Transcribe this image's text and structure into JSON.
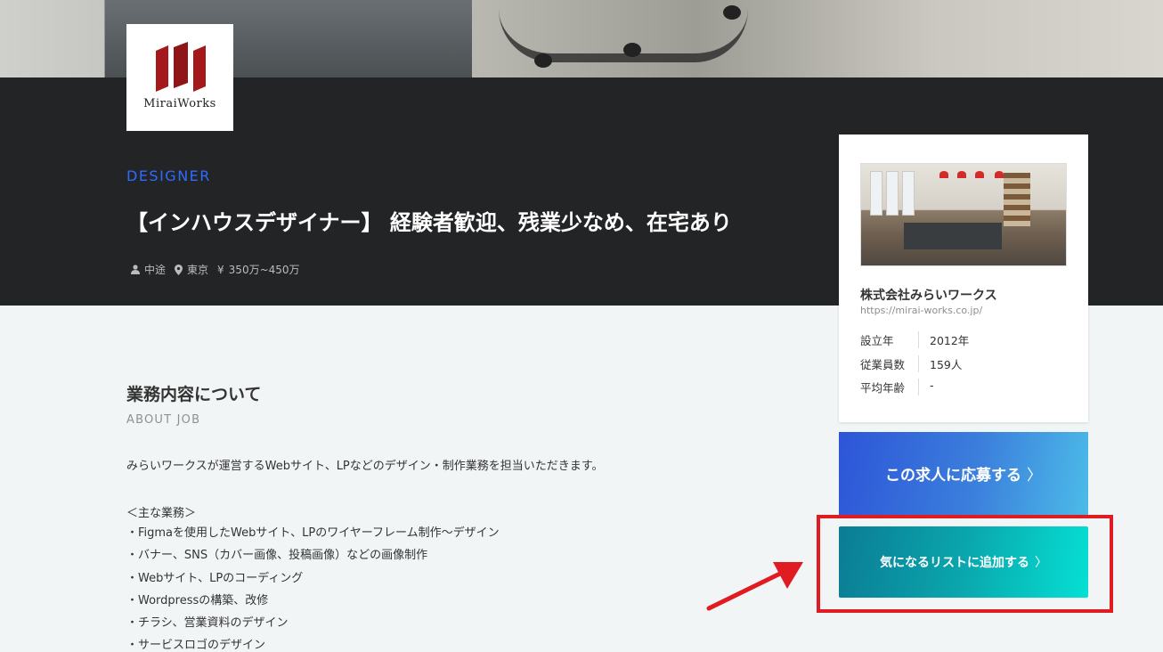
{
  "logo": {
    "text": "MiraiWorks",
    "brand_color": "#a3191c"
  },
  "job": {
    "category": "DESIGNER",
    "title": "【インハウスデザイナー】 経験者歓迎、残業少なめ、在宅あり",
    "employment_type": "中途",
    "location": "東京",
    "salary": "350万~450万",
    "icons": {
      "employment": "person-icon",
      "location": "map-pin-icon",
      "salary": "yen-icon"
    }
  },
  "section": {
    "title": "業務内容について",
    "subtitle": "ABOUT JOB",
    "lead": "みらいワークスが運営するWebサイト、LPなどのデザイン・制作業務を担当いただきます。",
    "duties_heading": "＜主な業務＞",
    "duties": [
      "・Figmaを使用したWebサイト、LPのワイヤーフレーム制作〜デザイン",
      "・バナー、SNS（カバー画像、投稿画像）などの画像制作",
      "・Webサイト、LPのコーディング",
      "・Wordpressの構築、改修",
      "・チラシ、営業資料のデザイン",
      "・サービスロゴのデザイン"
    ]
  },
  "company": {
    "name": "株式会社みらいワークス",
    "url": "https://mirai-works.co.jp/",
    "info": [
      {
        "label": "設立年",
        "value": "2012年"
      },
      {
        "label": "従業員数",
        "value": "159人"
      },
      {
        "label": "平均年齢",
        "value": "-"
      }
    ]
  },
  "actions": {
    "apply_label": "この求人に応募する",
    "save_label": "気になるリストに追加する",
    "chevron": "〉"
  },
  "annotation": {
    "highlight_color": "#e01b22",
    "arrow_color": "#e01b22"
  }
}
